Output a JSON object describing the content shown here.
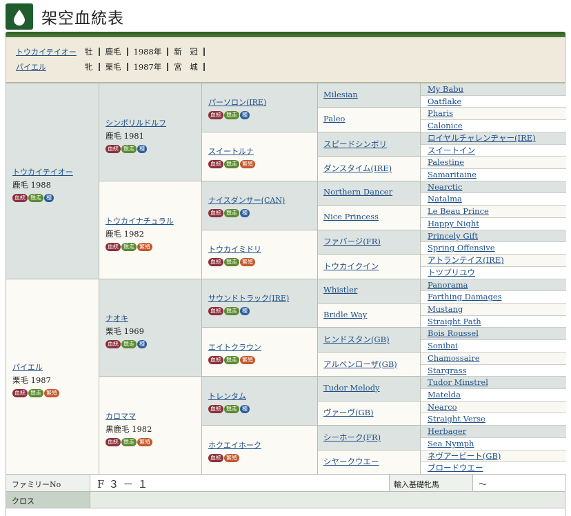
{
  "header": {
    "title": "架空血統表"
  },
  "summary": [
    {
      "name": "トウカイテイオー",
      "sex": "牡",
      "color": "鹿毛",
      "year": "1988年",
      "place": "新　冠"
    },
    {
      "name": "パイエル",
      "sex": "牝",
      "color": "栗毛",
      "year": "1987年",
      "place": "宮　城"
    }
  ],
  "badge_labels": {
    "blood": "血統",
    "race": "競走",
    "seed": "種",
    "breed": "繁殖"
  },
  "gen1": [
    {
      "name": "トウカイテイオー",
      "info": "鹿毛 1988",
      "badges": [
        "blood",
        "race",
        "seed"
      ]
    },
    {
      "name": "パイエル",
      "info": "栗毛 1987",
      "badges": [
        "blood",
        "race",
        "breed"
      ]
    }
  ],
  "gen2": [
    {
      "name": "シンボリルドルフ",
      "info": "鹿毛 1981",
      "badges": [
        "blood",
        "race",
        "seed"
      ]
    },
    {
      "name": "トウカイナチュラル",
      "info": "鹿毛 1982",
      "badges": [
        "blood",
        "race",
        "breed"
      ]
    },
    {
      "name": "ナオキ",
      "info": "栗毛 1969",
      "badges": [
        "blood",
        "race",
        "seed"
      ]
    },
    {
      "name": "カロママ",
      "info": "黒鹿毛 1982",
      "badges": [
        "blood",
        "race",
        "breed"
      ]
    }
  ],
  "gen3": [
    {
      "name": "パーソロン(IRE)",
      "badges": [
        "blood",
        "race",
        "seed"
      ]
    },
    {
      "name": "スイートルナ",
      "badges": [
        "blood",
        "race",
        "breed"
      ]
    },
    {
      "name": "ナイスダンサー(CAN)",
      "badges": [
        "blood",
        "race",
        "seed"
      ]
    },
    {
      "name": "トウカイミドリ",
      "badges": [
        "blood",
        "race",
        "breed"
      ]
    },
    {
      "name": "サウンドトラック(IRE)",
      "badges": [
        "blood",
        "race",
        "seed"
      ]
    },
    {
      "name": "エイトクラウン",
      "badges": [
        "blood",
        "race",
        "breed"
      ]
    },
    {
      "name": "トレンタム",
      "badges": [
        "blood",
        "race",
        "seed"
      ]
    },
    {
      "name": "ホクエイホーク",
      "badges": [
        "blood",
        "breed"
      ]
    }
  ],
  "gen4": [
    "Milesian",
    "Paleo",
    "スピードシンボリ",
    "ダンスタイム(IRE)",
    "Northern Dancer",
    "Nice Princess",
    "ファバージ(FR)",
    "トウカイクイン",
    "Whistler",
    "Bridle Way",
    "ヒンドスタン(GB)",
    "アルベンローザ(GB)",
    "Tudor Melody",
    "ヴァーヴ(GB)",
    "シーホーク(FR)",
    "シヤークウエー"
  ],
  "gen5": [
    "My Babu",
    "Oatflake",
    "Pharis",
    "Calonice",
    "ロイヤルチャレンヂャー(IRE)",
    "スイートイン",
    "Palestine",
    "Samaritaine",
    "Nearctic",
    "Natalma",
    "Le Beau Prince",
    "Happy Night",
    "Princely Gift",
    "Spring Offensive",
    "アトランテイス(IRE)",
    "トツプリユウ",
    "Panorama",
    "Farthing Damages",
    "Mustang",
    "Straight Path",
    "Bois Roussel",
    "Sonibai",
    "Chamossaire",
    "Stargrass",
    "Tudor Minstrel",
    "Matelda",
    "Nearco",
    "Straight Verse",
    "Herbager",
    "Sea Nymph",
    "ネヴアービート(GB)",
    "ブロードウエー"
  ],
  "bottom": {
    "family_label": "ファミリーNo",
    "family_value": "F３－１",
    "import_label": "輸入基礎牝馬",
    "import_value": "～",
    "cross_label": "クロス"
  }
}
